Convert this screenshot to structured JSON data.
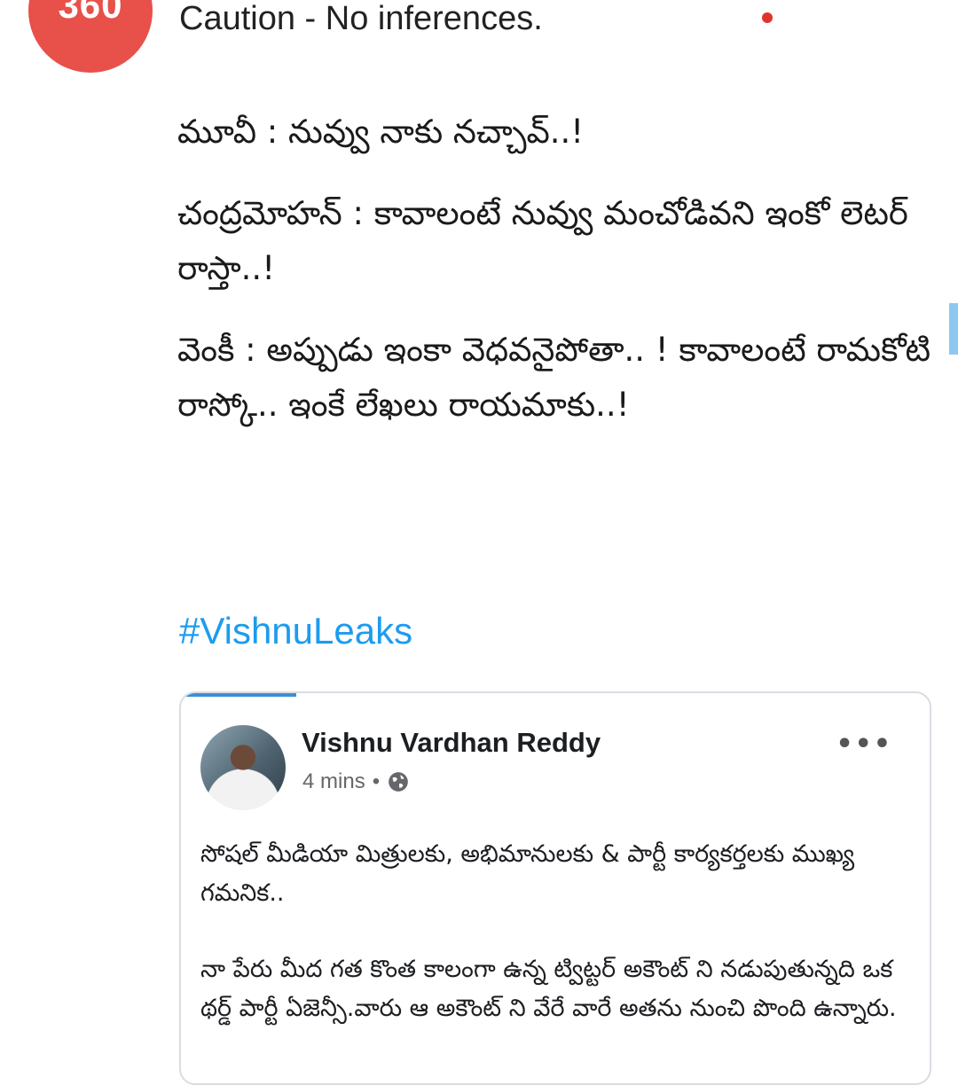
{
  "header": {
    "badge_text": "360",
    "caution_text": "Caution - No inferences."
  },
  "tweet": {
    "lines": [
      "మూవీ : నువ్వు నాకు నచ్చావ్..!",
      "చంద్రమోహన్ : కావాలంటే నువ్వు మంచోడివని ఇంకో లెటర్ రాస్తా..!",
      "వెంకీ :  అప్పుడు ఇంకా వెధవనైపోతా.. ! కావాలంటే రామకోటి రాస్కో.. ఇంకే లేఖలు రాయమాకు..!"
    ],
    "hashtag": "#VishnuLeaks"
  },
  "embedded_post": {
    "author": "Vishnu Vardhan Reddy",
    "time": "4 mins",
    "separator": "•",
    "paragraphs": [
      "సోషల్ మీడియా మిత్రులకు, అభిమానులకు & పార్టీ కార్యకర్తలకు ముఖ్య గమనిక..",
      "నా పేరు మీద గత కొంత కాలంగా ఉన్న ట్విట్టర్ అకౌంట్ ని నడుపుతున్నది ఒక థర్డ్ పార్టీ ఏజెన్సీ.వారు ఆ అకౌంట్ ని వేరే వారే అతను నుంచి పొంది ఉన్నారు."
    ]
  },
  "colors": {
    "badge": "#e8504a",
    "hashtag": "#1d9bf0",
    "progress": "#3b8fd6"
  },
  "icons": [
    "globe-icon",
    "more-options-icon",
    "avatar-360-badge",
    "profile-avatar"
  ]
}
